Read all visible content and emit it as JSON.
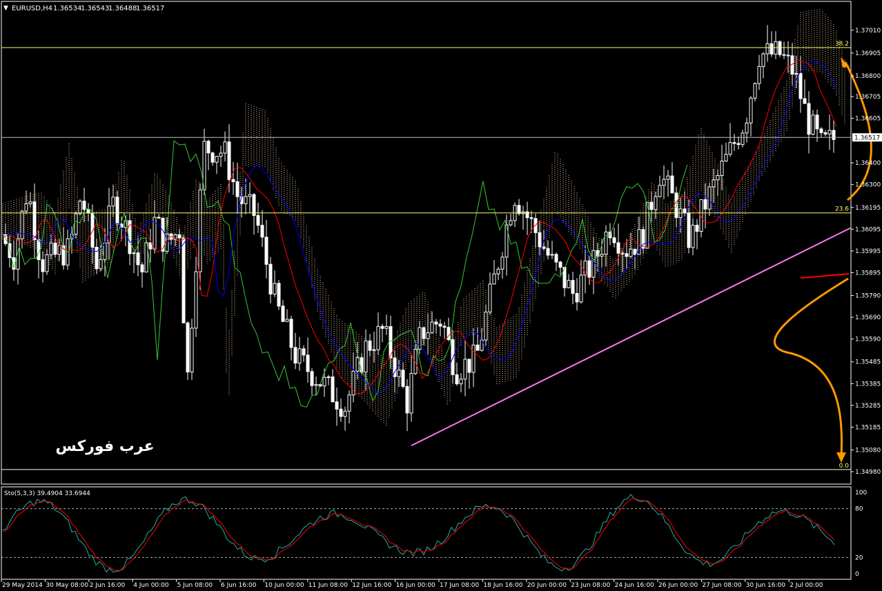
{
  "header": {
    "menu_glyph": "▼",
    "symbol": "EURUSD,H4",
    "ohlc": [
      "1.36534",
      "1.36543",
      "1.36488",
      "1.36517"
    ]
  },
  "watermark": "عرب فوركس",
  "price_tag": "1.36517",
  "colors": {
    "background": "#000000",
    "frame": "#ffffff",
    "candle": "#ffffff",
    "candle_up_body": "#000000",
    "tenkan": "#ff0000",
    "kijun": "#0000ff",
    "chikou": "#33cc33",
    "kumo": "#f5d0a9",
    "fibo": "#ffff66",
    "trendline": "#ff77ee",
    "arrow": "#ff9900",
    "stoch_main": "#20b2aa",
    "stoch_signal": "#ff0000"
  },
  "indicator_labels": {
    "stoch": "Sto(5,3,3) 39.4904 33.6944"
  },
  "chart_data": [
    {
      "type": "candlestick",
      "title": "EURUSD,H4",
      "ylim": [
        1.3498,
        1.3706
      ],
      "y_ticks": [
        "1.37010",
        "1.36905",
        "1.36800",
        "1.36705",
        "1.36605",
        "1.36400",
        "1.36300",
        "1.36195",
        "1.36095",
        "1.35995",
        "1.35895",
        "1.35790",
        "1.35690",
        "1.35590",
        "1.35485",
        "1.35385",
        "1.35285",
        "1.35185",
        "1.35080",
        "1.34980"
      ],
      "x_ticks": [
        "29 May 2014",
        "30 May 08:00",
        "2 Jun 16:00",
        "4 Jun 00:00",
        "5 Jun 08:00",
        "6 Jun 16:00",
        "10 Jun 00:00",
        "11 Jun 08:00",
        "12 Jun 16:00",
        "16 Jun 00:00",
        "17 Jun 08:00",
        "18 Jun 16:00",
        "20 Jun 00:00",
        "23 Jun 08:00",
        "24 Jun 16:00",
        "26 Jun 00:00",
        "27 Jun 08:00",
        "30 Jun 16:00",
        "2 Jul 00:00"
      ],
      "fibonacci": {
        "levels": [
          {
            "label": "38.2",
            "price": 1.3693
          },
          {
            "label": "23.6",
            "price": 1.3617
          },
          {
            "label": "0.0",
            "price": 1.3499
          }
        ]
      },
      "current_price": 1.36517,
      "trendline": {
        "from": [
          "16 Jun 00:00",
          1.351
        ],
        "to": [
          "2 Jul 20:00",
          1.361
        ]
      },
      "series": [
        {
          "name": "Ichimoku Tenkan-sen",
          "color": "#ff0000"
        },
        {
          "name": "Ichimoku Kijun-sen",
          "color": "#0000ff"
        },
        {
          "name": "Ichimoku Chikou Span",
          "color": "#33cc33"
        },
        {
          "name": "Ichimoku Kumo",
          "color": "#f5d0a9"
        }
      ],
      "annotations": [
        "orange arrow up to 38.2 level",
        "orange arrow down to 0.0 level",
        "red horizontal segment near 1.3589"
      ]
    },
    {
      "type": "line",
      "title": "Sto(5,3,3) 39.4904 33.6944",
      "ylim": [
        0,
        100
      ],
      "y_ticks": [
        "100",
        "80",
        "20",
        "0"
      ],
      "levels": [
        80,
        20
      ],
      "series": [
        {
          "name": "main",
          "value": 39.4904,
          "color": "#20b2aa"
        },
        {
          "name": "signal",
          "value": 33.6944,
          "color": "#ff0000"
        }
      ]
    }
  ]
}
